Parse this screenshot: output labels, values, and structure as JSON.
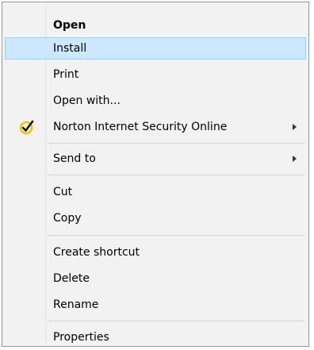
{
  "menu": {
    "items": [
      {
        "label": "Open"
      },
      {
        "label": "Install"
      },
      {
        "label": "Print"
      },
      {
        "label": "Open with..."
      },
      {
        "label": "Norton Internet Security Online",
        "icon": "norton-check-icon"
      },
      {
        "label": "Send to"
      },
      {
        "label": "Cut"
      },
      {
        "label": "Copy"
      },
      {
        "label": "Create shortcut"
      },
      {
        "label": "Delete"
      },
      {
        "label": "Rename"
      },
      {
        "label": "Properties"
      }
    ]
  },
  "colors": {
    "highlight": "#cce8ff",
    "highlight_border": "#99d1ff",
    "menu_background": "#f2f2f2",
    "norton_yellow": "#f5c400"
  }
}
